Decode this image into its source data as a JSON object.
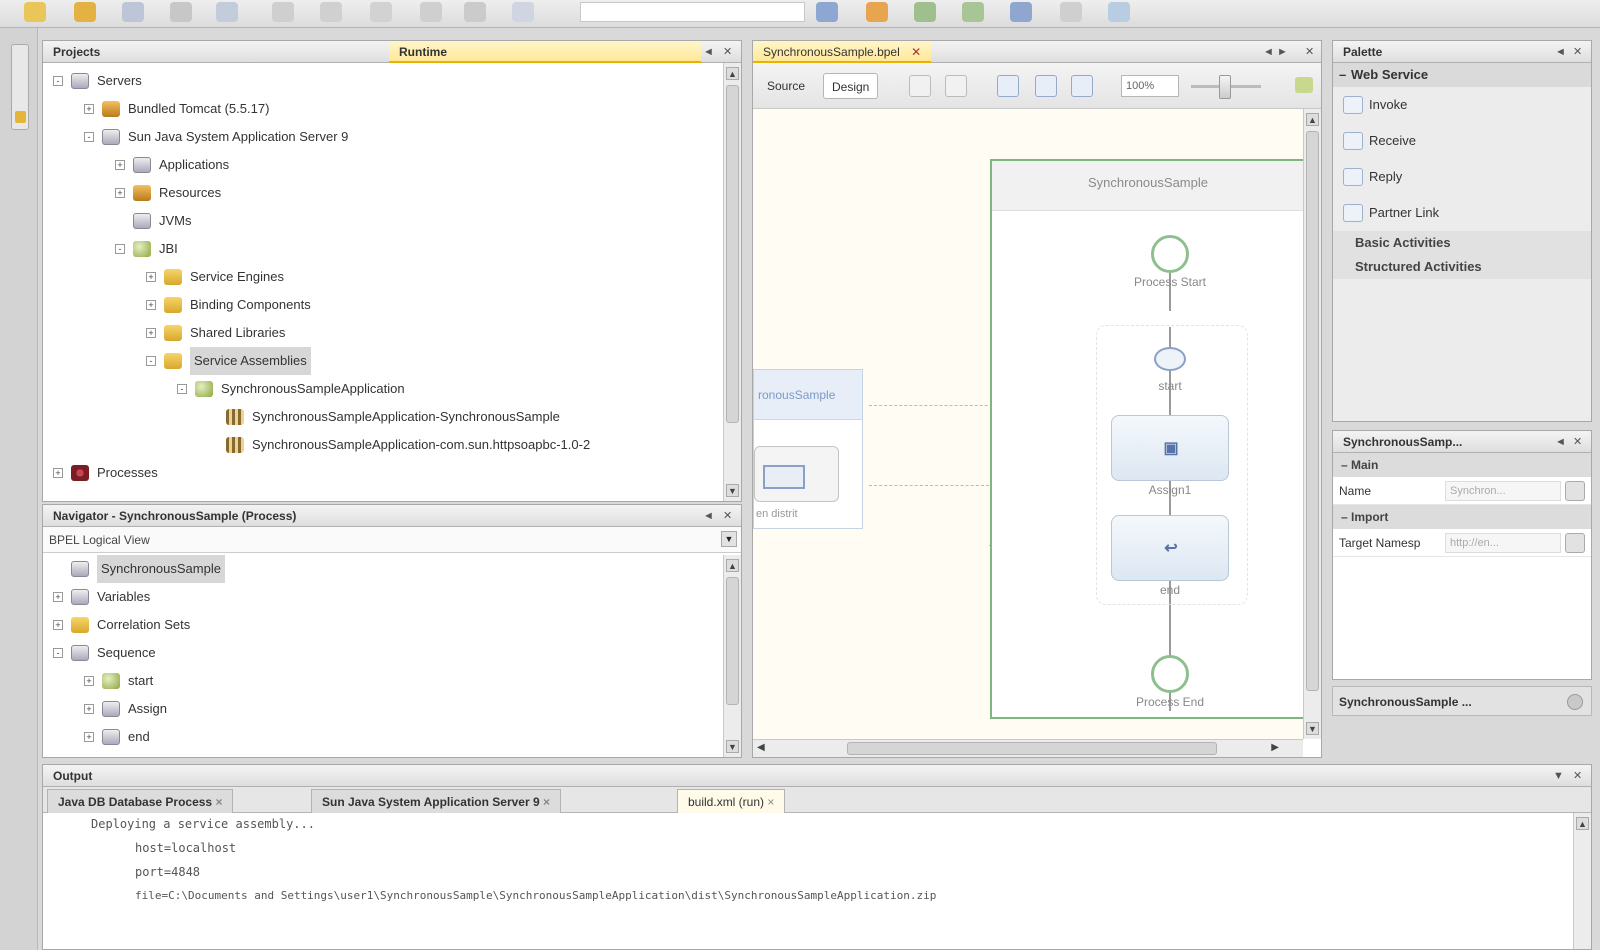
{
  "projects_panel": {
    "tabs": [
      {
        "label": "Projects",
        "active": false
      },
      {
        "label": "Runtime",
        "active": true
      }
    ],
    "tree": [
      {
        "label": "Servers",
        "level": 0,
        "expander": "-",
        "icon": "servers-icon"
      },
      {
        "label": "Bundled Tomcat (5.5.17)",
        "level": 1,
        "expander": "+",
        "icon": "tomcat-icon"
      },
      {
        "label": "Sun Java System Application Server 9",
        "level": 1,
        "expander": "-",
        "icon": "server-icon"
      },
      {
        "label": "Applications",
        "level": 2,
        "expander": "+",
        "icon": "applications-icon"
      },
      {
        "label": "Resources",
        "level": 2,
        "expander": "+",
        "icon": "resources-icon"
      },
      {
        "label": "JVMs",
        "level": 2,
        "expander": "",
        "icon": "jvm-icon"
      },
      {
        "label": "JBI",
        "level": 2,
        "expander": "-",
        "icon": "jbi-icon"
      },
      {
        "label": "Service Engines",
        "level": 3,
        "expander": "+",
        "icon": "folder-icon"
      },
      {
        "label": "Binding Components",
        "level": 3,
        "expander": "+",
        "icon": "folder-icon"
      },
      {
        "label": "Shared Libraries",
        "level": 3,
        "expander": "+",
        "icon": "folder-icon"
      },
      {
        "label": "Service Assemblies",
        "level": 3,
        "expander": "-",
        "icon": "folder-icon",
        "selected": true
      },
      {
        "label": "SynchronousSampleApplication",
        "level": 4,
        "expander": "-",
        "icon": "globe-icon"
      },
      {
        "label": "SynchronousSampleApplication-SynchronousSample",
        "level": 5,
        "expander": "",
        "icon": "jar-icon"
      },
      {
        "label": "SynchronousSampleApplication-com.sun.httpsoapbc-1.0-2",
        "level": 5,
        "expander": "",
        "icon": "jar-icon"
      },
      {
        "label": "Processes",
        "level": 0,
        "expander": "+",
        "icon": "gear-icon"
      }
    ]
  },
  "navigator_panel": {
    "title": "Navigator - SynchronousSample (Process)",
    "view_select": "BPEL Logical View",
    "tree": [
      {
        "label": "SynchronousSample",
        "level": 0,
        "expander": "",
        "icon": "process-icon",
        "selected": true
      },
      {
        "label": "Variables",
        "level": 0,
        "expander": "+",
        "icon": "variables-icon"
      },
      {
        "label": "Correlation Sets",
        "level": 0,
        "expander": "+",
        "icon": "folder-icon"
      },
      {
        "label": "Sequence",
        "level": 0,
        "expander": "-",
        "icon": "sequence-icon"
      },
      {
        "label": "start",
        "level": 1,
        "expander": "+",
        "icon": "receive-icon"
      },
      {
        "label": "Assign",
        "level": 1,
        "expander": "+",
        "icon": "assign-icon"
      },
      {
        "label": "end",
        "level": 1,
        "expander": "+",
        "icon": "reply-icon"
      }
    ]
  },
  "editor": {
    "tab_label": "SynchronousSample.bpel",
    "source_label": "Source",
    "design_label": "Design",
    "zoom": "100%",
    "process_name": "SynchronousSample",
    "partner_name": "ronousSample",
    "partner_sub": "en distrit",
    "process_start": "Process Start",
    "start_label": "start",
    "assign_label": "Assign1",
    "end_label": "end",
    "process_end": "Process End"
  },
  "palette": {
    "title": "Palette",
    "sections": [
      {
        "label": "Web Service",
        "items": [
          "Invoke",
          "Receive",
          "Reply",
          "Partner Link"
        ]
      }
    ],
    "collapsed": [
      "Basic Activities",
      "Structured Activities"
    ]
  },
  "properties": {
    "title": "SynchronousSamp...",
    "group_main": "Main",
    "name_label": "Name",
    "name_value": "Synchron...",
    "group_import": "Import",
    "target_label": "Target Namesp",
    "target_value": "http://en...",
    "footer": "SynchronousSample ..."
  },
  "output": {
    "title": "Output",
    "tabs": [
      {
        "label": "Java DB Database Process",
        "active": false
      },
      {
        "label": "Sun Java System Application Server 9",
        "active": false
      },
      {
        "label": "build.xml (run)",
        "active": true
      }
    ],
    "lines": [
      "Deploying a service assembly...",
      "host=localhost",
      "port=4848",
      "file=C:\\Documents and Settings\\user1\\SynchronousSample\\SynchronousSampleApplication\\dist\\SynchronousSampleApplication.zip"
    ]
  }
}
